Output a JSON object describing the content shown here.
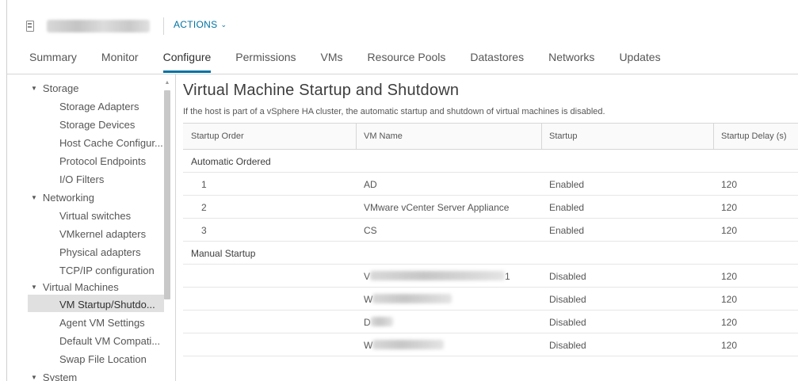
{
  "header": {
    "actions_label": "ACTIONS"
  },
  "tabs": [
    {
      "label": "Summary"
    },
    {
      "label": "Monitor"
    },
    {
      "label": "Configure"
    },
    {
      "label": "Permissions"
    },
    {
      "label": "VMs"
    },
    {
      "label": "Resource Pools"
    },
    {
      "label": "Datastores"
    },
    {
      "label": "Networks"
    },
    {
      "label": "Updates"
    }
  ],
  "sidebar": {
    "storage": {
      "label": "Storage",
      "items": [
        "Storage Adapters",
        "Storage Devices",
        "Host Cache Configur...",
        "Protocol Endpoints",
        "I/O Filters"
      ]
    },
    "networking": {
      "label": "Networking",
      "items": [
        "Virtual switches",
        "VMkernel adapters",
        "Physical adapters",
        "TCP/IP configuration"
      ]
    },
    "virtual_machines": {
      "label": "Virtual Machines",
      "items": [
        "VM Startup/Shutdo...",
        "Agent VM Settings",
        "Default VM Compati...",
        "Swap File Location"
      ]
    },
    "system": {
      "label": "System"
    }
  },
  "main": {
    "title": "Virtual Machine Startup and Shutdown",
    "description": "If the host is part of a vSphere HA cluster, the automatic startup and shutdown of virtual machines is disabled.",
    "columns": [
      "Startup Order",
      "VM Name",
      "Startup",
      "Startup Delay (s)"
    ],
    "groups": {
      "automatic": "Automatic Ordered",
      "manual": "Manual Startup"
    },
    "automatic_rows": [
      {
        "order": "1",
        "name": "AD",
        "startup": "Enabled",
        "delay": "120"
      },
      {
        "order": "2",
        "name": "VMware vCenter Server Appliance",
        "startup": "Enabled",
        "delay": "120"
      },
      {
        "order": "3",
        "name": "CS",
        "startup": "Enabled",
        "delay": "120"
      }
    ],
    "manual_rows": [
      {
        "name_prefix": "V",
        "name_suffix": "1",
        "startup": "Disabled",
        "delay": "120"
      },
      {
        "name_prefix": "W",
        "name_suffix": "",
        "startup": "Disabled",
        "delay": "120"
      },
      {
        "name_prefix": "D",
        "name_suffix": "",
        "startup": "Disabled",
        "delay": "120"
      },
      {
        "name_prefix": "W",
        "name_suffix": "",
        "startup": "Disabled",
        "delay": "120"
      }
    ]
  }
}
